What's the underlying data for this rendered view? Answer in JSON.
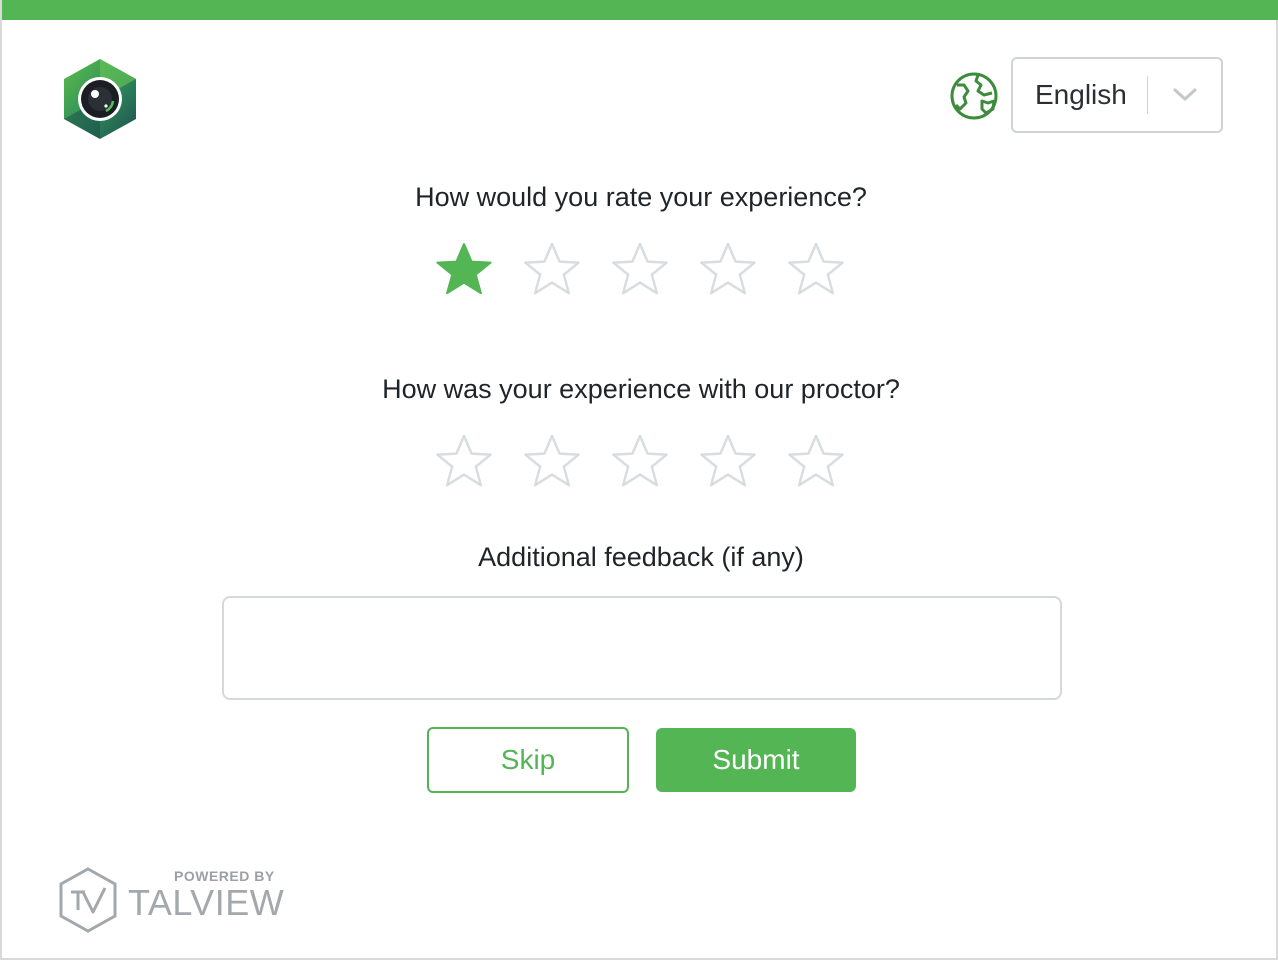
{
  "header": {
    "language": {
      "selected": "English",
      "icon": "globe-icon"
    }
  },
  "rating_experience": {
    "question": "How would you rate your experience?",
    "rating": 1,
    "max": 5
  },
  "rating_proctor": {
    "question": "How was your experience with our proctor?",
    "rating": 0,
    "max": 5
  },
  "feedback": {
    "label": "Additional feedback (if any)",
    "value": "",
    "placeholder": ""
  },
  "actions": {
    "skip_label": "Skip",
    "submit_label": "Submit"
  },
  "footer": {
    "powered_by": "POWERED BY",
    "brand": "TALVIEW"
  },
  "colors": {
    "accent": "#53b553",
    "star_empty_stroke": "#d8dde1",
    "globe": "#3c8c3c"
  }
}
